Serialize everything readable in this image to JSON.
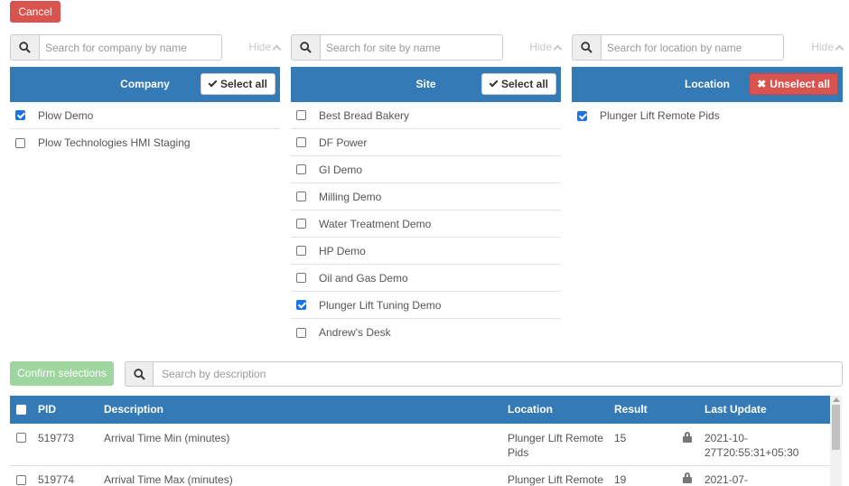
{
  "actions": {
    "cancel_label": "Cancel",
    "confirm_label": "Confirm selections"
  },
  "colors": {
    "primary": "#337ab7",
    "danger": "#d9534f",
    "success_disabled": "#9fd59f",
    "checkbox": "#1a73e8"
  },
  "company": {
    "search_placeholder": "Search for company by name",
    "hide_label": "Hide",
    "header": "Company",
    "action_label": "Select all",
    "items": [
      {
        "label": "Plow Demo",
        "checked": true
      },
      {
        "label": "Plow Technologies HMI Staging",
        "checked": false
      }
    ]
  },
  "site": {
    "search_placeholder": "Search for site by name",
    "hide_label": "Hide",
    "header": "Site",
    "action_label": "Select all",
    "items": [
      {
        "label": "Best Bread Bakery",
        "checked": false
      },
      {
        "label": "DF Power",
        "checked": false
      },
      {
        "label": "GI Demo",
        "checked": false
      },
      {
        "label": "Milling Demo",
        "checked": false
      },
      {
        "label": "Water Treatment Demo",
        "checked": false
      },
      {
        "label": "HP Demo",
        "checked": false
      },
      {
        "label": "Oil and Gas Demo",
        "checked": false
      },
      {
        "label": "Plunger Lift Tuning Demo",
        "checked": true
      },
      {
        "label": "Andrew's Desk",
        "checked": false
      }
    ]
  },
  "location": {
    "search_placeholder": "Search for location by name",
    "hide_label": "Hide",
    "header": "Location",
    "action_label": "Unselect all",
    "items": [
      {
        "label": "Plunger Lift Remote Pids",
        "checked": true
      }
    ]
  },
  "description_search": {
    "placeholder": "Search by description"
  },
  "table": {
    "columns": {
      "pid": "PID",
      "description": "Description",
      "location": "Location",
      "result": "Result",
      "last_update": "Last Update"
    },
    "rows": [
      {
        "pid": "519773",
        "description": "Arrival Time Min (minutes)",
        "location_line1": "Plunger Lift Remote",
        "location_line2": "Pids",
        "result": "15",
        "last_update_line1": "2021-10-",
        "last_update_line2": "27T20:55:31+05:30"
      },
      {
        "pid": "519774",
        "description": "Arrival Time Max (minutes)",
        "location_line1": "Plunger Lift Remote",
        "location_line2": "",
        "result": "19",
        "last_update_line1": "2021-07-",
        "last_update_line2": ""
      }
    ]
  }
}
